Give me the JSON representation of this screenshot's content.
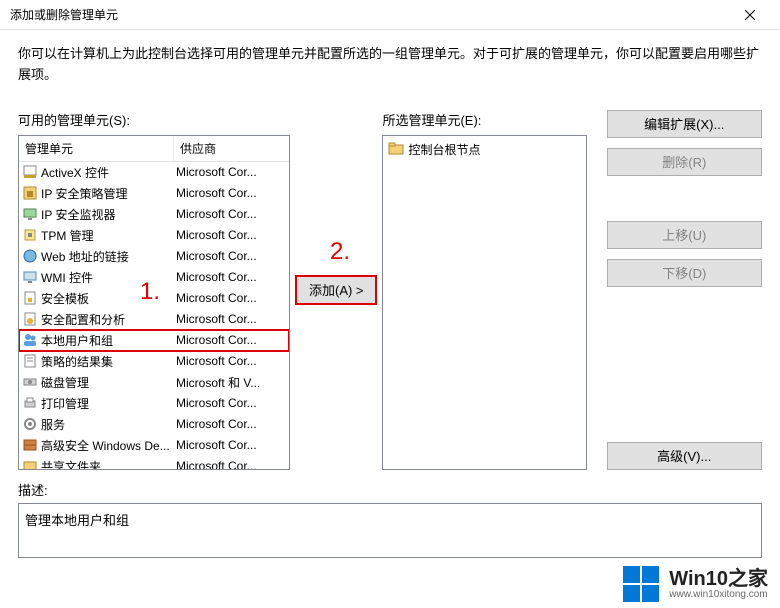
{
  "window": {
    "title": "添加或删除管理单元"
  },
  "intro": "你可以在计算机上为此控制台选择可用的管理单元并配置所选的一组管理单元。对于可扩展的管理单元，你可以配置要启用哪些扩展项。",
  "available_label": "可用的管理单元(S):",
  "selected_label": "所选管理单元(E):",
  "col_snapin": "管理单元",
  "col_vendor": "供应商",
  "snapins": [
    {
      "name": "ActiveX 控件",
      "vendor": "Microsoft Cor...",
      "icon": "activex"
    },
    {
      "name": "IP 安全策略管理",
      "vendor": "Microsoft Cor...",
      "icon": "ipsec"
    },
    {
      "name": "IP 安全监视器",
      "vendor": "Microsoft Cor...",
      "icon": "ipsec-mon"
    },
    {
      "name": "TPM 管理",
      "vendor": "Microsoft Cor...",
      "icon": "tpm"
    },
    {
      "name": "Web 地址的链接",
      "vendor": "Microsoft Cor...",
      "icon": "weblink"
    },
    {
      "name": "WMI 控件",
      "vendor": "Microsoft Cor...",
      "icon": "wmi"
    },
    {
      "name": "安全模板",
      "vendor": "Microsoft Cor...",
      "icon": "sectpl"
    },
    {
      "name": "安全配置和分析",
      "vendor": "Microsoft Cor...",
      "icon": "seccfg"
    },
    {
      "name": "本地用户和组",
      "vendor": "Microsoft Cor...",
      "icon": "users",
      "selected": true
    },
    {
      "name": "策略的结果集",
      "vendor": "Microsoft Cor...",
      "icon": "rsop"
    },
    {
      "name": "磁盘管理",
      "vendor": "Microsoft 和 V...",
      "icon": "disk"
    },
    {
      "name": "打印管理",
      "vendor": "Microsoft Cor...",
      "icon": "print"
    },
    {
      "name": "服务",
      "vendor": "Microsoft Cor...",
      "icon": "services"
    },
    {
      "name": "高级安全 Windows De...",
      "vendor": "Microsoft Cor...",
      "icon": "firewall"
    },
    {
      "name": "共享文件夹",
      "vendor": "Microsoft Cor...",
      "icon": "share"
    }
  ],
  "tree_root": "控制台根节点",
  "buttons": {
    "edit_ext": "编辑扩展(X)...",
    "remove": "删除(R)",
    "move_up": "上移(U)",
    "move_down": "下移(D)",
    "advanced": "高级(V)...",
    "add": "添加(A) >"
  },
  "desc_label": "描述:",
  "desc_text": "管理本地用户和组",
  "annotations": {
    "one": "1.",
    "two": "2."
  },
  "watermark": {
    "title": "Win10之家",
    "url": "www.win10xitong.com"
  }
}
